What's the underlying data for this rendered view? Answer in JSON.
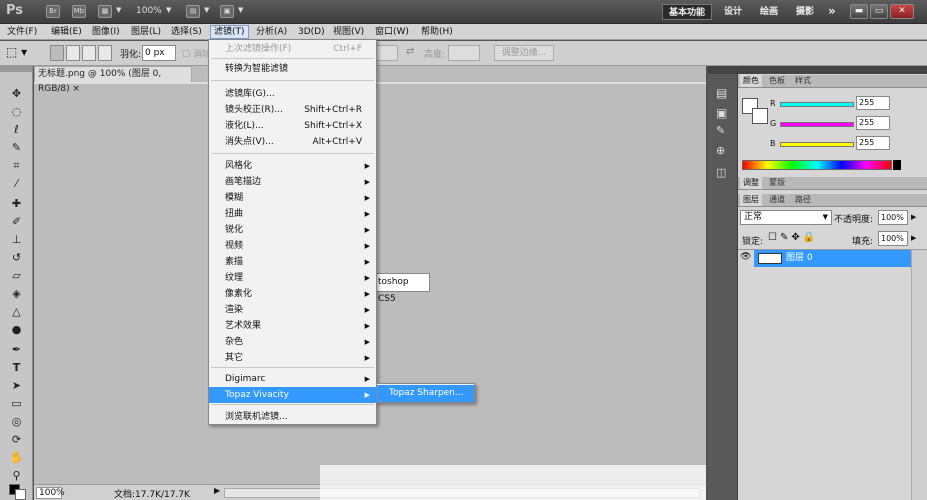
{
  "appbar": {
    "logo": "Ps",
    "icons": [
      "Br",
      "Mb"
    ],
    "zoom": "100%",
    "workspaces": [
      "基本功能",
      "设计",
      "绘画",
      "摄影"
    ],
    "more": "»",
    "search_icon": "search-icon"
  },
  "menubar": [
    "文件(F)",
    "编辑(E)",
    "图像(I)",
    "图层(L)",
    "选择(S)",
    "滤镜(T)",
    "分析(A)",
    "3D(D)",
    "视图(V)",
    "窗口(W)",
    "帮助(H)"
  ],
  "options": {
    "feather_label": "羽化:",
    "feather_value": "0 px",
    "antialias": "消除",
    "height_label": "高度:",
    "refine_edge": "调整边缘..."
  },
  "document": {
    "tab_title": "无标题.png @ 100% (图层 0, RGB/8)",
    "canvas_text": "toshop CS5",
    "zoom": "100%",
    "doc_info": "文档:17.7K/17.7K"
  },
  "filter_menu": {
    "items": [
      {
        "label": "上次滤镜操作(F)",
        "shortcut": "Ctrl+F",
        "disabled": true
      },
      {
        "label": "转换为智能滤镜"
      },
      {
        "label": "滤镜库(G)..."
      },
      {
        "label": "镜头校正(R)...",
        "shortcut": "Shift+Ctrl+R"
      },
      {
        "label": "液化(L)...",
        "shortcut": "Shift+Ctrl+X"
      },
      {
        "label": "消失点(V)...",
        "shortcut": "Alt+Ctrl+V"
      },
      {
        "label": "风格化",
        "submenu": true
      },
      {
        "label": "画笔描边",
        "submenu": true
      },
      {
        "label": "模糊",
        "submenu": true
      },
      {
        "label": "扭曲",
        "submenu": true
      },
      {
        "label": "锐化",
        "submenu": true
      },
      {
        "label": "视频",
        "submenu": true
      },
      {
        "label": "素描",
        "submenu": true
      },
      {
        "label": "纹理",
        "submenu": true
      },
      {
        "label": "像素化",
        "submenu": true
      },
      {
        "label": "渲染",
        "submenu": true
      },
      {
        "label": "艺术效果",
        "submenu": true
      },
      {
        "label": "杂色",
        "submenu": true
      },
      {
        "label": "其它",
        "submenu": true
      },
      {
        "label": "Digimarc",
        "submenu": true
      },
      {
        "label": "Topaz Vivacity",
        "submenu": true,
        "highlighted": true
      },
      {
        "label": "浏览联机滤镜..."
      }
    ],
    "submenu_item": "Topaz Sharpen..."
  },
  "color_panel": {
    "tabs": [
      "颜色",
      "色板",
      "样式"
    ],
    "channels": [
      {
        "label": "R",
        "value": "255",
        "gradient": "#00ffff"
      },
      {
        "label": "G",
        "value": "255",
        "gradient": "#ff00ff"
      },
      {
        "label": "B",
        "value": "255",
        "gradient": "#ffff00"
      }
    ]
  },
  "adjust_tabs": [
    "调整",
    "蒙版"
  ],
  "layers_panel": {
    "tabs": [
      "图层",
      "通道",
      "路径"
    ],
    "blend_mode": "正常",
    "opacity_label": "不透明度:",
    "opacity": "100%",
    "lock_label": "锁定:",
    "fill_label": "填充:",
    "fill": "100%",
    "layer_name": "图层 0"
  },
  "colors": {
    "highlight": "#3399ff",
    "menu_bg": "#f2f2f2"
  }
}
